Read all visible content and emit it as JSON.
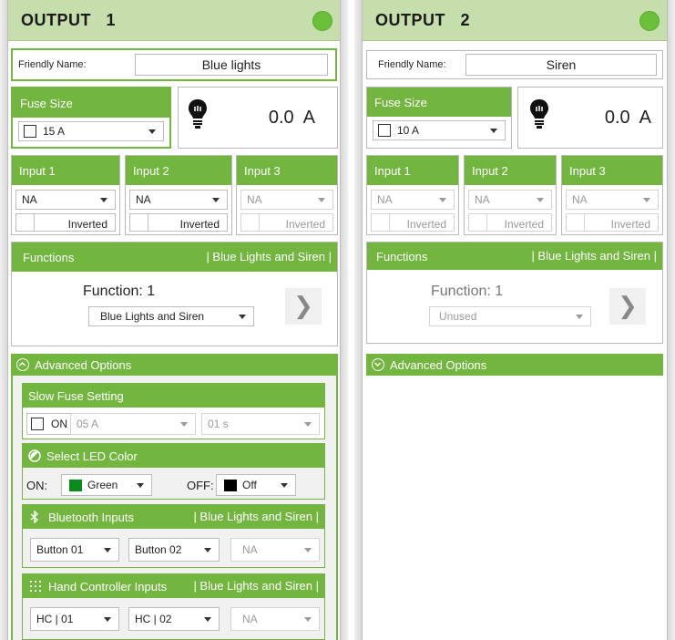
{
  "outputs": [
    {
      "title": "OUTPUT   1",
      "friendly_name_label": "Friendly Name:",
      "friendly_name": "Blue lights",
      "fuse_size_label": "Fuse Size",
      "fuse_value": "15 A",
      "current": "0.0  A",
      "inputs": [
        {
          "label": "Input 1",
          "value": "NA",
          "inverted": "Inverted",
          "disabled": false
        },
        {
          "label": "Input 2",
          "value": "NA",
          "inverted": "Inverted",
          "disabled": false
        },
        {
          "label": "Input 3",
          "value": "NA",
          "inverted": "Inverted",
          "disabled": true
        }
      ],
      "functions_label": "Functions",
      "functions_tag": "| Blue Lights and Siren |",
      "function_title": "Function: 1",
      "function_value": "Blue Lights and Siren",
      "advanced_label": "Advanced Options",
      "slow_fuse": {
        "header": "Slow Fuse Setting",
        "on_label": "ON",
        "amp": "05 A",
        "time": "01 s"
      },
      "led": {
        "header": "Select LED Color",
        "on_label": "ON:",
        "on_value": "Green",
        "on_color": "#0a8a1a",
        "off_label": "OFF:",
        "off_value": "Off",
        "off_color": "#000000"
      },
      "bluetooth": {
        "header": "Bluetooth Inputs",
        "tag": "| Blue Lights and Siren |",
        "b1": "Button 01",
        "b2": "Button 02",
        "b3": "NA"
      },
      "hand": {
        "header": "Hand Controller Inputs",
        "tag": "| Blue Lights and Siren |",
        "h1": "HC | 01",
        "h2": "HC | 02",
        "h3": "NA"
      }
    },
    {
      "title": "OUTPUT   2",
      "friendly_name_label": "Friendly Name:",
      "friendly_name": "Siren",
      "fuse_size_label": "Fuse Size",
      "fuse_value": "10 A",
      "current": "0.0  A",
      "inputs": [
        {
          "label": "Input 1",
          "value": "NA",
          "inverted": "Inverted",
          "disabled": true
        },
        {
          "label": "Input 2",
          "value": "NA",
          "inverted": "Inverted",
          "disabled": true
        },
        {
          "label": "Input 3",
          "value": "NA",
          "inverted": "Inverted",
          "disabled": true
        }
      ],
      "functions_label": "Functions",
      "functions_tag": "| Blue Lights and Siren |",
      "function_title": "Function: 1",
      "function_value": "Unused",
      "advanced_label": "Advanced Options"
    }
  ],
  "colors": {
    "accent_green": "#72b640",
    "header_green": "#c5deab",
    "status_green": "#6abf3b"
  }
}
